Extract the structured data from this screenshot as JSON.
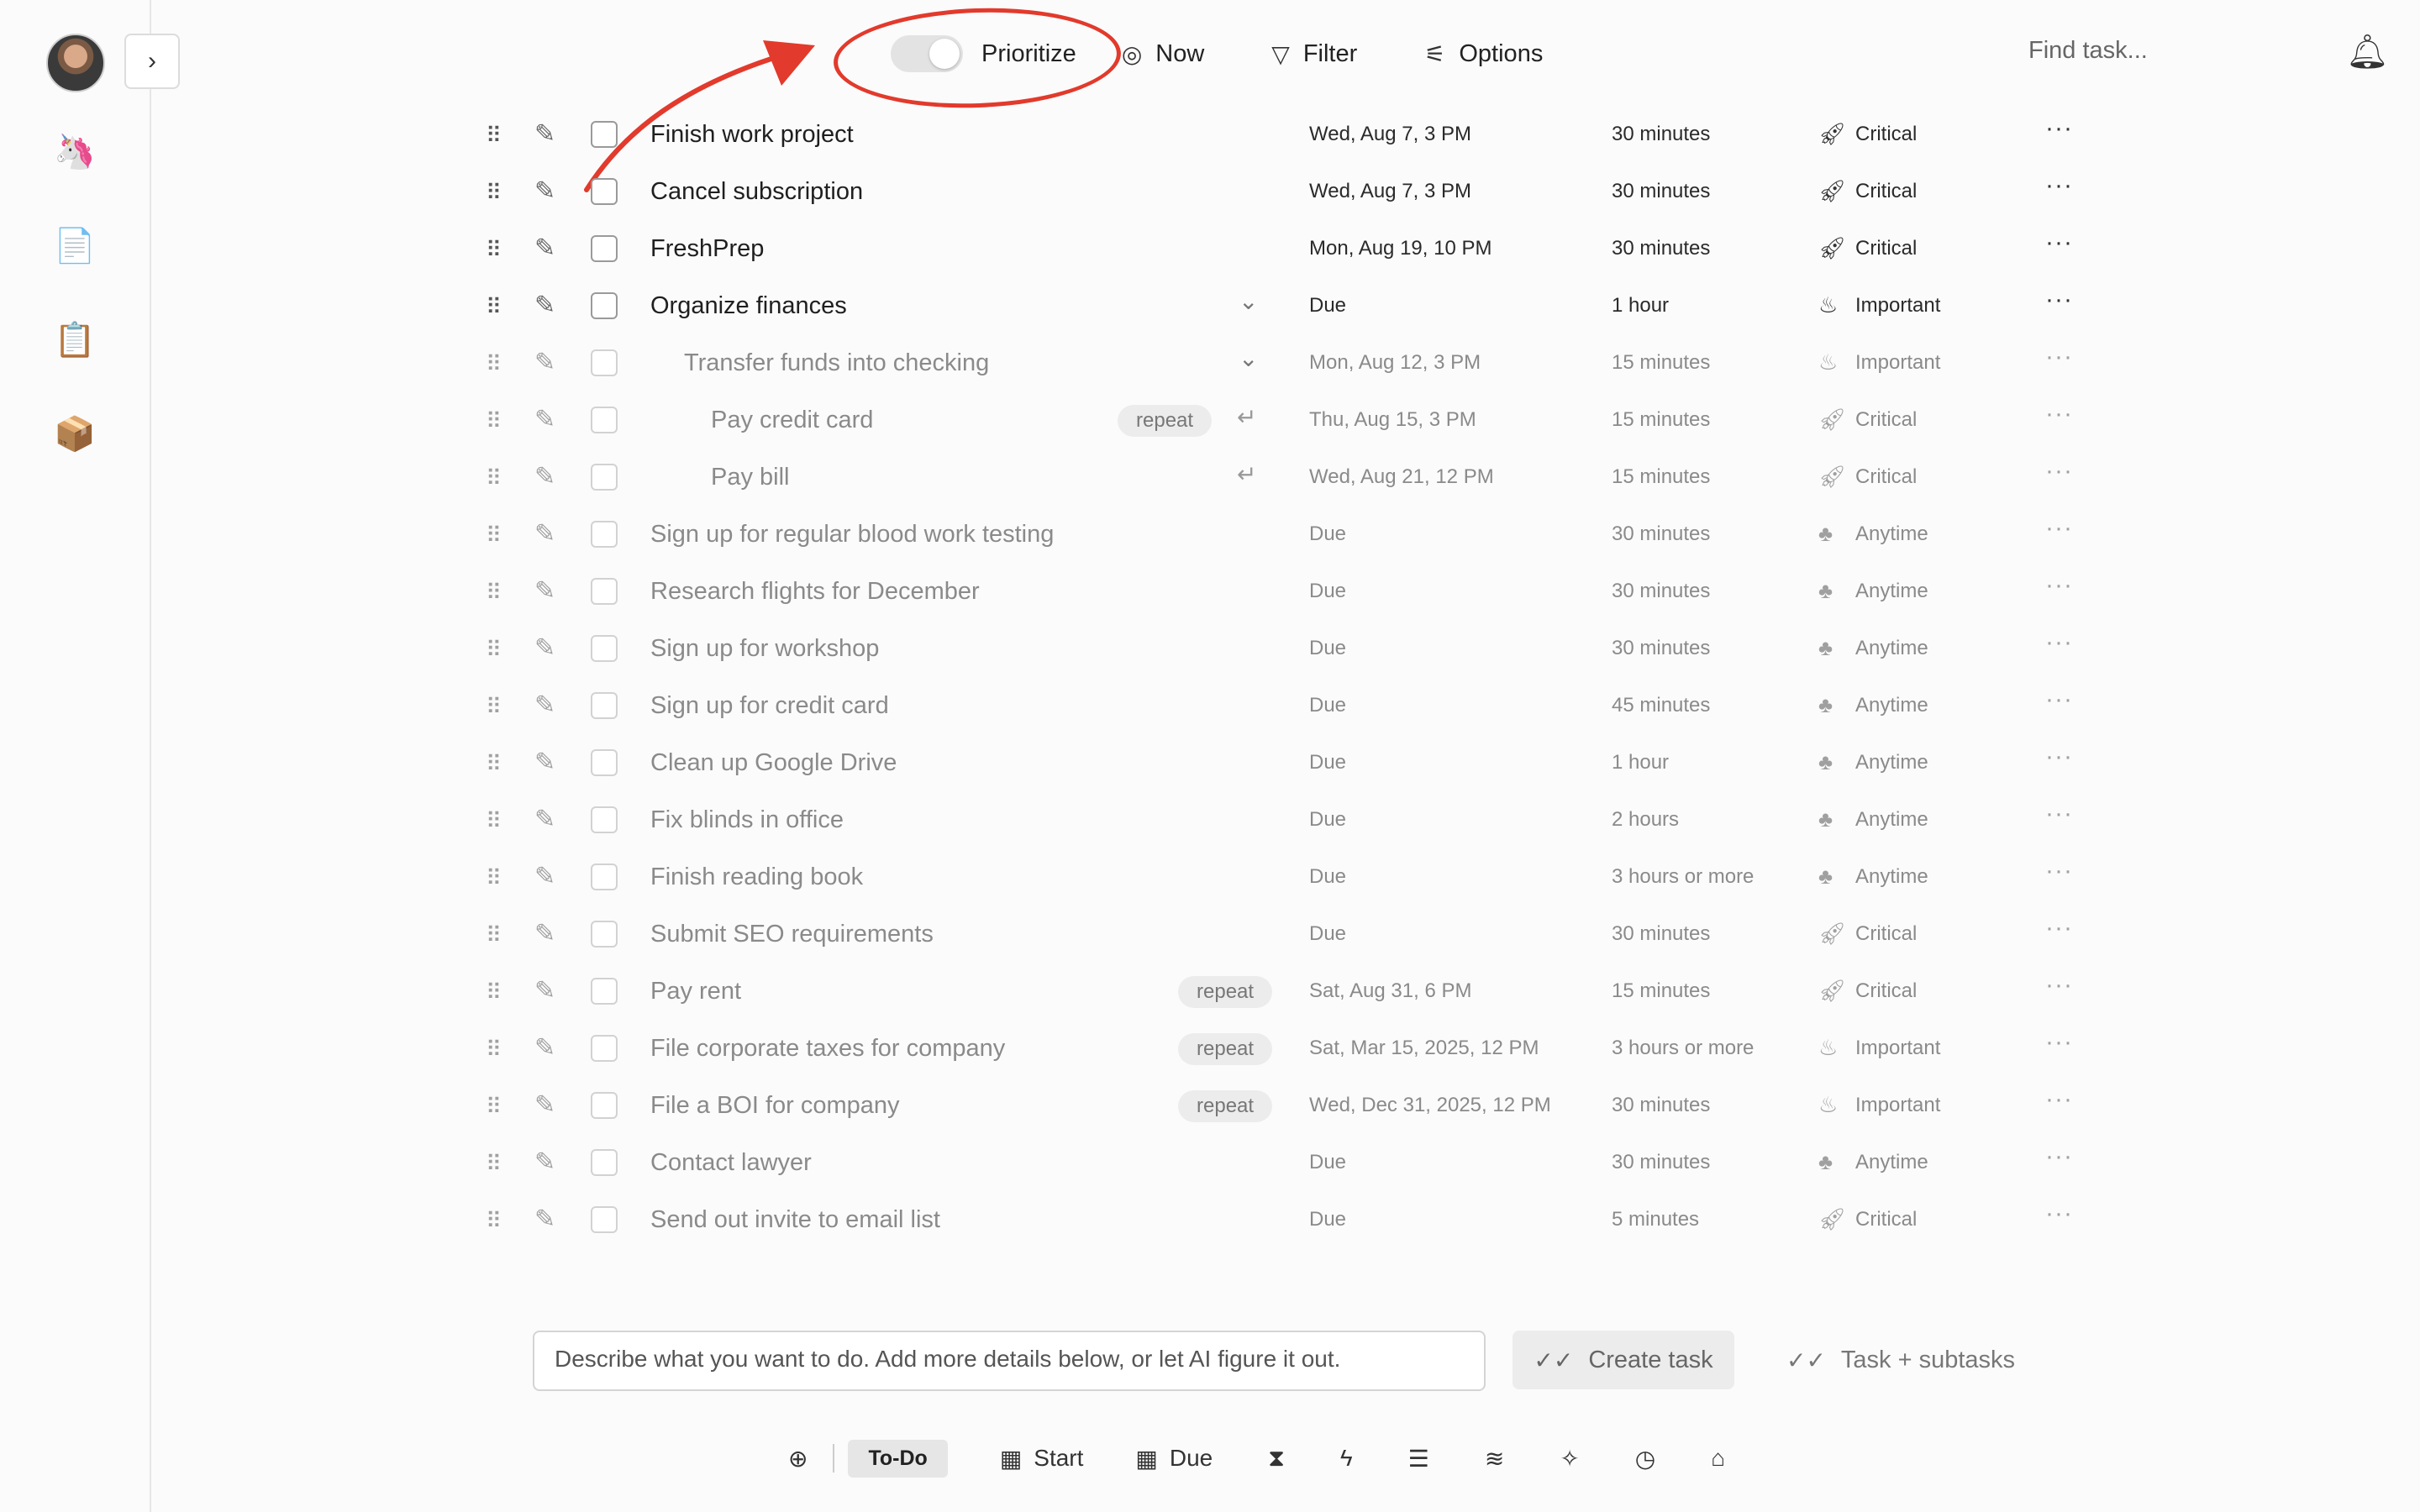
{
  "sidebar": {
    "expand_icon": "chevron-right-icon",
    "items": [
      {
        "name": "unicorn",
        "glyph": "🦄"
      },
      {
        "name": "document",
        "glyph": "📄"
      },
      {
        "name": "clipboard",
        "glyph": "📋"
      },
      {
        "name": "package",
        "glyph": "📦"
      }
    ]
  },
  "toolbar": {
    "prioritize_label": "Prioritize",
    "prioritize_on": false,
    "now_label": "Now",
    "filter_label": "Filter",
    "options_label": "Options",
    "search_placeholder": "Find task..."
  },
  "annotation": {
    "color": "#e23a2c"
  },
  "tasks": [
    {
      "title": "Finish work project",
      "date": "Wed, Aug 7, 3 PM",
      "duration": "30 minutes",
      "priority": "Critical",
      "dim": false,
      "indent": 0
    },
    {
      "title": "Cancel subscription",
      "date": "Wed, Aug 7, 3 PM",
      "duration": "30 minutes",
      "priority": "Critical",
      "dim": false,
      "indent": 0
    },
    {
      "title": "FreshPrep",
      "date": "Mon, Aug 19, 10 PM",
      "duration": "30 minutes",
      "priority": "Critical",
      "dim": false,
      "indent": 0
    },
    {
      "title": "Organize finances",
      "date": "Due",
      "duration": "1 hour",
      "priority": "Important",
      "dim": false,
      "indent": 0,
      "expand": true
    },
    {
      "title": "Transfer funds into checking",
      "date": "Mon, Aug 12, 3 PM",
      "duration": "15 minutes",
      "priority": "Important",
      "dim": true,
      "indent": 1,
      "expand": true
    },
    {
      "title": "Pay credit card",
      "date": "Thu, Aug 15, 3 PM",
      "duration": "15 minutes",
      "priority": "Critical",
      "dim": true,
      "indent": 2,
      "chip": "repeat",
      "return": true
    },
    {
      "title": "Pay bill",
      "date": "Wed, Aug 21, 12 PM",
      "duration": "15 minutes",
      "priority": "Critical",
      "dim": true,
      "indent": 2,
      "return": true
    },
    {
      "title": "Sign up for regular blood work testing",
      "date": "Due",
      "duration": "30 minutes",
      "priority": "Anytime",
      "dim": true,
      "indent": 0
    },
    {
      "title": "Research flights for December",
      "date": "Due",
      "duration": "30 minutes",
      "priority": "Anytime",
      "dim": true,
      "indent": 0
    },
    {
      "title": "Sign up for workshop",
      "date": "Due",
      "duration": "30 minutes",
      "priority": "Anytime",
      "dim": true,
      "indent": 0
    },
    {
      "title": "Sign up for credit card",
      "date": "Due",
      "duration": "45 minutes",
      "priority": "Anytime",
      "dim": true,
      "indent": 0
    },
    {
      "title": "Clean up Google Drive",
      "date": "Due",
      "duration": "1 hour",
      "priority": "Anytime",
      "dim": true,
      "indent": 0
    },
    {
      "title": "Fix blinds in office",
      "date": "Due",
      "duration": "2 hours",
      "priority": "Anytime",
      "dim": true,
      "indent": 0
    },
    {
      "title": "Finish reading book",
      "date": "Due",
      "duration": "3 hours or more",
      "priority": "Anytime",
      "dim": true,
      "indent": 0
    },
    {
      "title": "Submit SEO requirements",
      "date": "Due",
      "duration": "30 minutes",
      "priority": "Critical",
      "dim": true,
      "indent": 0
    },
    {
      "title": "Pay rent",
      "date": "Sat, Aug 31, 6 PM",
      "duration": "15 minutes",
      "priority": "Critical",
      "dim": true,
      "indent": 0,
      "chip": "repeat"
    },
    {
      "title": "File corporate taxes for company",
      "date": "Sat, Mar 15, 2025, 12 PM",
      "duration": "3 hours or more",
      "priority": "Important",
      "dim": true,
      "indent": 0,
      "chip": "repeat"
    },
    {
      "title": "File a BOI for company",
      "date": "Wed, Dec 31, 2025, 12 PM",
      "duration": "30 minutes",
      "priority": "Important",
      "dim": true,
      "indent": 0,
      "chip": "repeat"
    },
    {
      "title": "Contact lawyer",
      "date": "Due",
      "duration": "30 minutes",
      "priority": "Anytime",
      "dim": true,
      "indent": 0
    },
    {
      "title": "Send out invite to email list",
      "date": "Due",
      "duration": "5 minutes",
      "priority": "Critical",
      "dim": true,
      "indent": 0
    }
  ],
  "priority_icons": {
    "Critical": "rocket-icon",
    "Important": "flame-icon",
    "Anytime": "palm-tree-icon"
  },
  "composer": {
    "placeholder": "Describe what you want to do. Add more details below, or let AI figure it out.",
    "create_label": "Create task",
    "subtasks_label": "Task + subtasks"
  },
  "bottombar": {
    "todo_label": "To-Do",
    "start_label": "Start",
    "due_label": "Due"
  }
}
